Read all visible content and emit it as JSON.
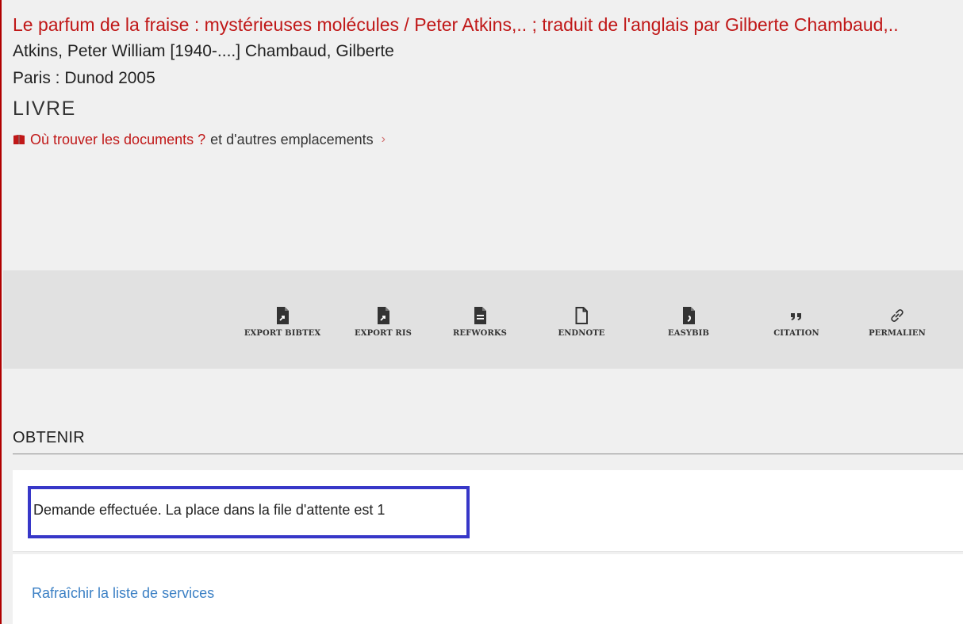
{
  "record": {
    "title": "Le parfum de la fraise : mystérieuses molécules / Peter Atkins,.. ; traduit de l'anglais par Gilberte Chambaud,..",
    "authors": "Atkins, Peter William [1940-....] Chambaud, Gilberte",
    "publisher": "Paris : Dunod 2005",
    "type": "LIVRE",
    "availability_link": "Où trouver les documents ?",
    "availability_rest": "et d'autres emplacements",
    "chevron": "›"
  },
  "actions": [
    {
      "label": "EXPORT BIBTEX",
      "icon": "export-bibtex-icon"
    },
    {
      "label": "EXPORT RIS",
      "icon": "export-ris-icon"
    },
    {
      "label": "REFWORKS",
      "icon": "refworks-icon"
    },
    {
      "label": "ENDNOTE",
      "icon": "endnote-icon"
    },
    {
      "label": "EASYBIB",
      "icon": "easybib-icon"
    },
    {
      "label": "CITATION",
      "icon": "quote-icon"
    },
    {
      "label": "PERMALIEN",
      "icon": "link-icon"
    }
  ],
  "obtain": {
    "heading": "OBTENIR",
    "status": "Demande effectuée. La place dans la file d'attente est 1",
    "refresh_link": "Rafraîchir la liste de services"
  },
  "colors": {
    "title_red": "#c01818",
    "highlight_border": "#3737c8",
    "link_blue": "#3a7fc4",
    "toolbar_bg": "#e1e1e1"
  }
}
